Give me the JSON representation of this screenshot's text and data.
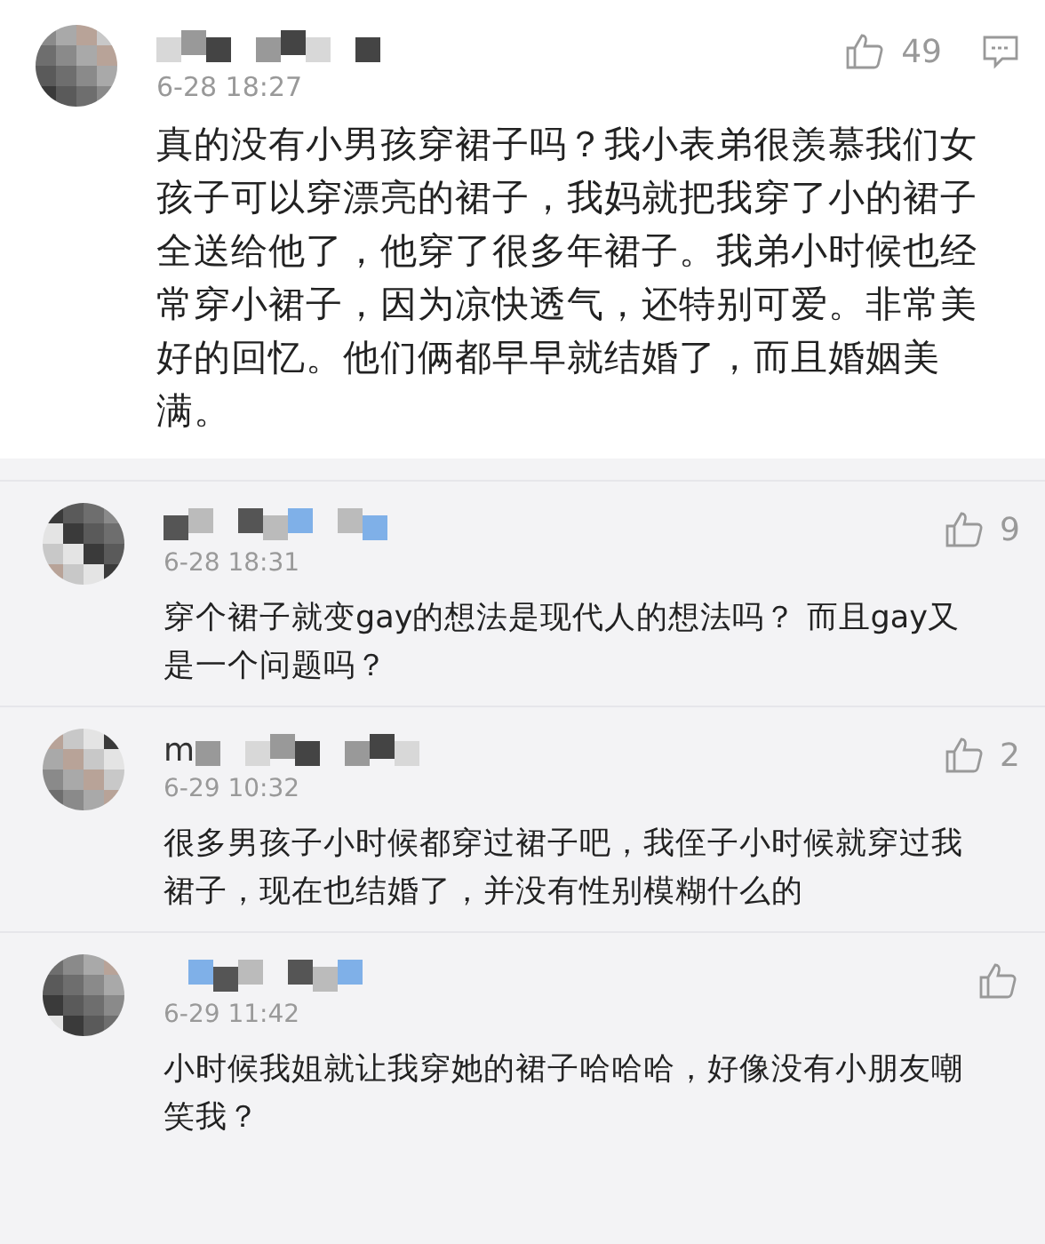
{
  "comments": [
    {
      "highlighted": true,
      "time": "6-28 18:27",
      "likes": "49",
      "reply_icon": true,
      "text": "真的没有小男孩穿裙子吗？我小表弟很羡慕我们女孩子可以穿漂亮的裙子，我妈就把我穿了小的裙子全送给他了，他穿了很多年裙子。我弟小时候也经常穿小裙子，因为凉快透气，还特别可爱。非常美好的回忆。他们俩都早早就结婚了，而且婚姻美满。"
    },
    {
      "highlighted": false,
      "time": "6-28 18:31",
      "likes": "9",
      "reply_icon": false,
      "text": "穿个裙子就变gay的想法是现代人的想法吗？ 而且gay又是一个问题吗？"
    },
    {
      "highlighted": false,
      "name_prefix": "m",
      "time": "6-29 10:32",
      "likes": "2",
      "reply_icon": false,
      "text": "很多男孩子小时候都穿过裙子吧，我侄子小时候就穿过我裙子，现在也结婚了，并没有性别模糊什么的"
    },
    {
      "highlighted": false,
      "time": "6-29 11:42",
      "reply_icon": false,
      "text": "小时候我姐就让我穿她的裙子哈哈哈，好像没有小朋友嘲笑我？"
    }
  ]
}
